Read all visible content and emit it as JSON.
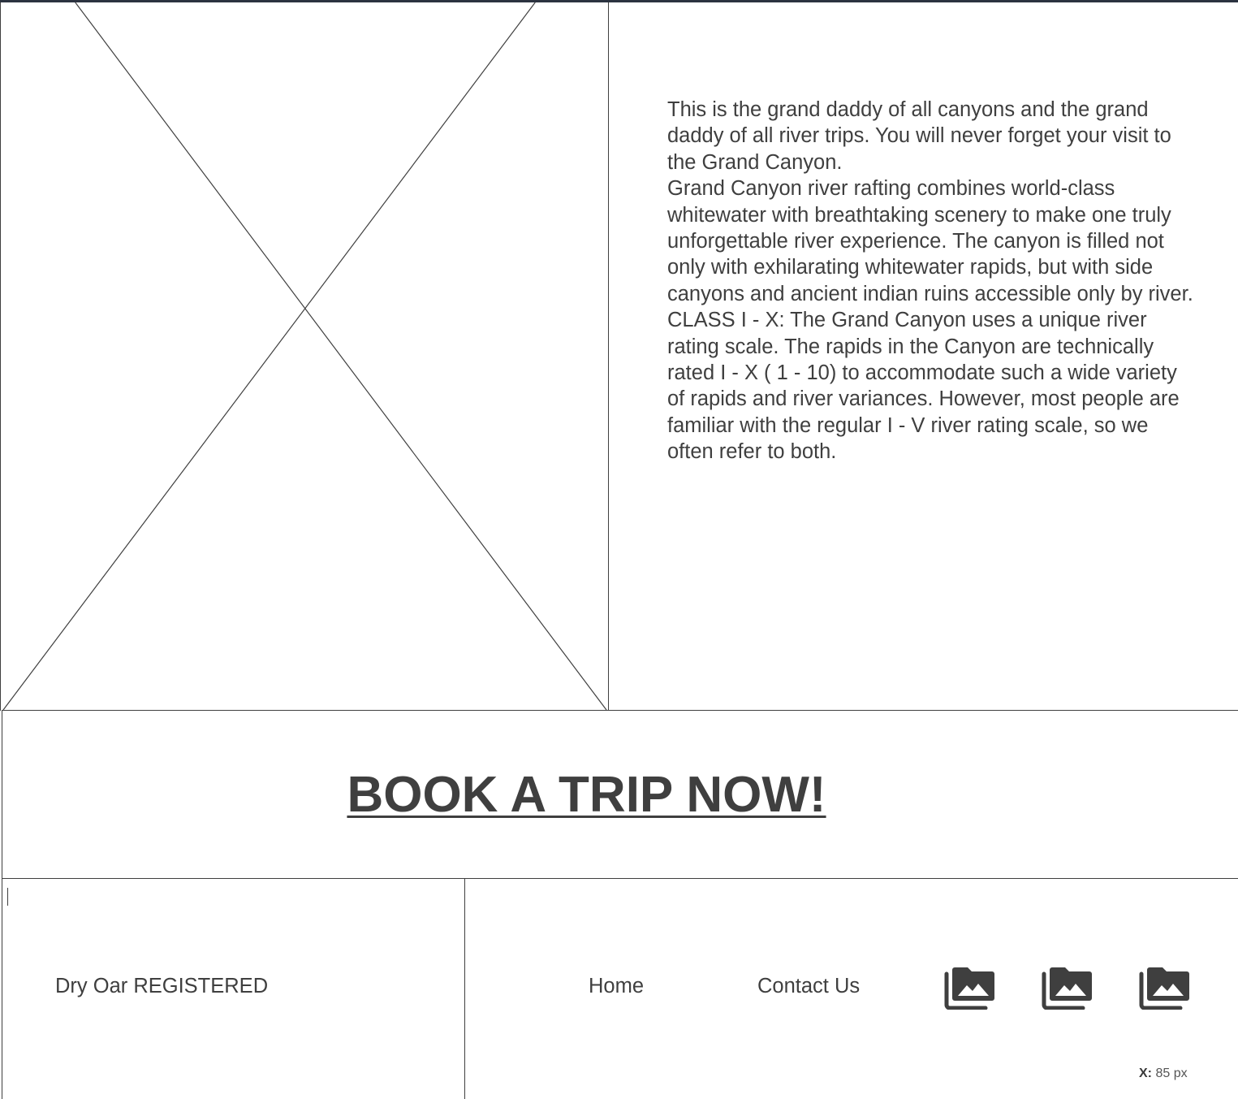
{
  "description": {
    "paragraphs": [
      "This is the grand daddy of all canyons and the grand daddy of all river trips. You will never forget your visit to the Grand Canyon.",
      "Grand Canyon river rafting combines world-class whitewater with breathtaking scenery to make one truly unforgettable river experience. The canyon is filled not only with exhilarating whitewater rapids, but with side canyons and ancient indian ruins accessible only by river.",
      "CLASS I - X: The Grand Canyon uses a unique river rating scale. The rapids in the Canyon are technically rated I - X ( 1 - 10) to accommodate such a wide variety of rapids and river variances. However, most people are familiar with the regular I - V river rating scale, so we often refer to both."
    ]
  },
  "cta": {
    "label": "BOOK A TRIP NOW!"
  },
  "footer": {
    "brand": "Dry Oar REGISTERED",
    "nav": {
      "home": "Home",
      "contact": "Contact Us"
    },
    "icons": [
      "photo-library-icon",
      "photo-library-icon",
      "photo-library-icon"
    ]
  },
  "coordinate_readout": {
    "label": "X:",
    "value": "85 px"
  },
  "colors": {
    "text": "#3f3f3f",
    "top_bar": "#2c3340",
    "background": "#ffffff"
  }
}
